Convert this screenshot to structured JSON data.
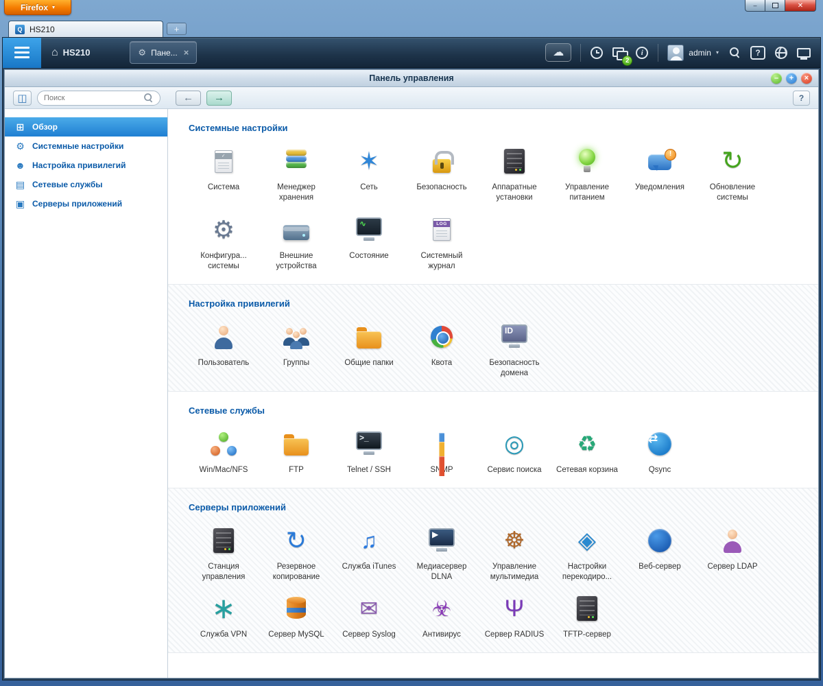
{
  "browser": {
    "menu_button_label": "Firefox",
    "menu_button_caret": "▾",
    "tab_title": "HS210",
    "favicon_letter": "Q",
    "new_tab_label": "+",
    "window_controls": {
      "minimize": "–",
      "close": "✕"
    }
  },
  "app_header": {
    "home_glyph": "⌂",
    "device_name": "HS210",
    "open_tab": {
      "gear_glyph": "⚙",
      "label": "Пане...",
      "close_glyph": "×"
    },
    "cloud_glyph": "☁",
    "badge_count": "2",
    "info_glyph": "i",
    "user_name": "admin",
    "user_caret": "▾",
    "help_glyph": "?"
  },
  "panel": {
    "title": "Панель управления",
    "window_buttons": {
      "minimize": "–",
      "maximize": "+",
      "close": "×"
    },
    "toolbar": {
      "toggle_glyph": "◫",
      "search_placeholder": "Поиск",
      "back_glyph": "←",
      "forward_glyph": "→",
      "help_glyph": "?"
    }
  },
  "sidebar": {
    "items": [
      {
        "label": "Обзор",
        "glyph": "⊞",
        "icon": "overview",
        "active": true
      },
      {
        "label": "Системные настройки",
        "glyph": "⚙",
        "icon": "system-settings",
        "active": false
      },
      {
        "label": "Настройка привилегий",
        "glyph": "☻",
        "icon": "privilege-settings",
        "active": false
      },
      {
        "label": "Сетевые службы",
        "glyph": "▤",
        "icon": "network-services",
        "active": false
      },
      {
        "label": "Серверы приложений",
        "glyph": "▣",
        "icon": "application-servers",
        "active": false
      }
    ]
  },
  "sections": [
    {
      "title": "Системные настройки",
      "striped": false,
      "items": [
        {
          "label": "Система",
          "icon": {
            "name": "system-icon",
            "type": "doc",
            "band": "#98a4ae",
            "text": "✓"
          }
        },
        {
          "label": "Менеджер хранения",
          "icon": {
            "name": "storage-manager-icon",
            "type": "stack"
          }
        },
        {
          "label": "Сеть",
          "icon": {
            "name": "network-icon",
            "type": "glyph",
            "glyph": "✶",
            "color": "#2e86d8",
            "size": 36
          }
        },
        {
          "label": "Безопасность",
          "icon": {
            "name": "security-icon",
            "type": "lock"
          }
        },
        {
          "label": "Аппаратные установки",
          "icon": {
            "name": "hardware-icon",
            "type": "server"
          }
        },
        {
          "label": "Управление питанием",
          "icon": {
            "name": "power-icon",
            "type": "bulb"
          }
        },
        {
          "label": "Уведомления",
          "icon": {
            "name": "notification-icon",
            "type": "bubble"
          }
        },
        {
          "label": "Обновление системы",
          "icon": {
            "name": "firmware-update-icon",
            "type": "glyph",
            "glyph": "↻",
            "color": "#45a41e",
            "size": 38
          }
        },
        {
          "label": "Конфигура... системы",
          "icon": {
            "name": "system-configuration-icon",
            "type": "glyph",
            "glyph": "⚙",
            "color": "#6a7a92",
            "size": 36
          }
        },
        {
          "label": "Внешние устройства",
          "icon": {
            "name": "external-device-icon",
            "type": "drive"
          }
        },
        {
          "label": "Состояние",
          "icon": {
            "name": "system-status-icon",
            "type": "screen",
            "bg": "linear-gradient(#2c3a46,#141e28)",
            "fg": "#52e852",
            "text": "∿"
          }
        },
        {
          "label": "Системный журнал",
          "icon": {
            "name": "system-logs-icon",
            "type": "doc",
            "band": "#7a5aa8",
            "text": "LOG"
          }
        }
      ]
    },
    {
      "title": "Настройка привилегий",
      "striped": true,
      "items": [
        {
          "label": "Пользователь",
          "icon": {
            "name": "users-icon",
            "type": "person"
          }
        },
        {
          "label": "Группы",
          "icon": {
            "name": "groups-icon",
            "type": "people"
          }
        },
        {
          "label": "Общие папки",
          "icon": {
            "name": "shared-folders-icon",
            "type": "folder"
          }
        },
        {
          "label": "Квота",
          "icon": {
            "name": "quota-icon",
            "type": "pie"
          }
        },
        {
          "label": "Безопасность домена",
          "icon": {
            "name": "domain-security-icon",
            "type": "screen",
            "bg": "linear-gradient(#8a93b8,#5a6388)",
            "fg": "#ffffff",
            "text": "ID"
          }
        }
      ]
    },
    {
      "title": "Сетевые службы",
      "striped": false,
      "items": [
        {
          "label": "Win/Mac/NFS",
          "icon": {
            "name": "win-mac-nfs-icon",
            "type": "orbs"
          }
        },
        {
          "label": "FTP",
          "icon": {
            "name": "ftp-icon",
            "type": "folder"
          }
        },
        {
          "label": "Telnet / SSH",
          "icon": {
            "name": "telnet-ssh-icon",
            "type": "screen",
            "bg": "linear-gradient(#3a4550,#10181f)",
            "fg": "#e8eef2",
            "text": ">_"
          }
        },
        {
          "label": "SNMP",
          "icon": {
            "name": "snmp-icon",
            "type": "bars"
          }
        },
        {
          "label": "Сервис поиска",
          "icon": {
            "name": "service-discovery-icon",
            "type": "glyph",
            "glyph": "◎",
            "color": "#2a9ab8",
            "size": 34
          }
        },
        {
          "label": "Сетевая корзина",
          "icon": {
            "name": "network-recycle-bin-icon",
            "type": "glyph",
            "glyph": "♻",
            "color": "#28a878",
            "size": 32
          }
        },
        {
          "label": "Qsync",
          "icon": {
            "name": "qsync-icon",
            "type": "circle",
            "glyph": "⇄",
            "c1": "#5ab8f0",
            "c2": "#1878c8"
          }
        }
      ]
    },
    {
      "title": "Серверы приложений",
      "striped": true,
      "items": [
        {
          "label": "Станция управления",
          "icon": {
            "name": "station-manager-icon",
            "type": "server"
          }
        },
        {
          "label": "Резервное копирование",
          "icon": {
            "name": "backup-station-icon",
            "type": "glyph",
            "glyph": "↻",
            "color": "#2a7ad8",
            "size": 36
          }
        },
        {
          "label": "Служба iTunes",
          "icon": {
            "name": "itunes-service-icon",
            "type": "glyph",
            "glyph": "♫",
            "color": "#2a7ae0",
            "size": 32
          }
        },
        {
          "label": "Медиасервер DLNA",
          "icon": {
            "name": "dlna-media-server-icon",
            "type": "screen",
            "bg": "linear-gradient(#3a5a80,#1a2c48)",
            "fg": "#ffffff",
            "text": "▶"
          }
        },
        {
          "label": "Управление мультимедиа",
          "icon": {
            "name": "multimedia-management-icon",
            "type": "glyph",
            "glyph": "☸",
            "color": "#b0682a",
            "size": 34
          }
        },
        {
          "label": "Настройки перекодиро...",
          "icon": {
            "name": "transcode-settings-icon",
            "type": "glyph",
            "glyph": "◈",
            "color": "#2a8ad0",
            "size": 34
          }
        },
        {
          "label": "Веб-сервер",
          "icon": {
            "name": "web-server-icon",
            "type": "circle",
            "glyph": "",
            "c1": "#4a9ae8",
            "c2": "#1a5ab0"
          }
        },
        {
          "label": "Сервер LDAP",
          "icon": {
            "name": "ldap-server-icon",
            "type": "person",
            "var": "#9a5ab8"
          }
        },
        {
          "label": "Служба VPN",
          "icon": {
            "name": "vpn-service-icon",
            "type": "glyph",
            "glyph": "∗",
            "color": "#28a0a0",
            "size": 42
          }
        },
        {
          "label": "Сервер MySQL",
          "icon": {
            "name": "mysql-server-icon",
            "type": "db"
          }
        },
        {
          "label": "Сервер Syslog",
          "icon": {
            "name": "syslog-server-icon",
            "type": "glyph",
            "glyph": "✉",
            "color": "#8a5ab0",
            "size": 32
          }
        },
        {
          "label": "Антивирус",
          "icon": {
            "name": "antivirus-icon",
            "type": "glyph",
            "glyph": "☣",
            "color": "#8a3ab8",
            "size": 32
          }
        },
        {
          "label": "Сервер RADIUS",
          "icon": {
            "name": "radius-server-icon",
            "type": "glyph",
            "glyph": "Ψ",
            "color": "#7a3ab8",
            "size": 34
          }
        },
        {
          "label": "TFTP-сервер",
          "icon": {
            "name": "tftp-server-icon",
            "type": "server"
          }
        }
      ]
    }
  ],
  "colors": {
    "accent_blue": "#1f7fd2",
    "header_navy": "#1d3349",
    "section_title_blue": "#0a5aa8",
    "selected_sidebar": "#2a8fd8",
    "firefox_orange": "#f47c00"
  }
}
